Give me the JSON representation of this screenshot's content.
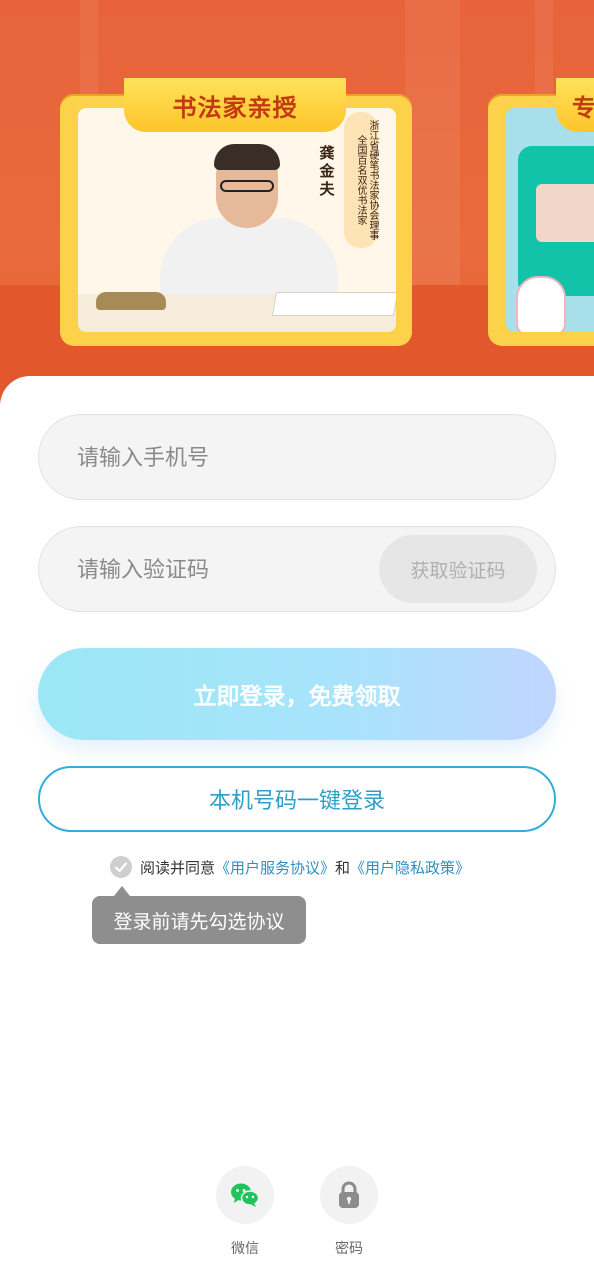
{
  "banner": {
    "card1": {
      "ribbon": "书法家亲授",
      "teacher_name": "龚金夫",
      "teacher_title": "浙江省硬笔书法家协会理事 全国百名双优书法家"
    },
    "card2": {
      "ribbon": "专"
    }
  },
  "form": {
    "phone_placeholder": "请输入手机号",
    "code_placeholder": "请输入验证码",
    "get_code": "获取验证码",
    "login": "立即登录，免费领取",
    "onekey_login": "本机号码一键登录"
  },
  "agreement": {
    "prefix": "阅读并同意",
    "service_link": "《用户服务协议》",
    "and": "和",
    "privacy_link": "《用户隐私政策》",
    "tooltip": "登录前请先勾选协议"
  },
  "alt_login": {
    "wechat_label": "微信",
    "password_label": "密码",
    "wechat_icon": "wechat-icon",
    "password_icon": "lock-icon"
  },
  "colors": {
    "banner": "#e8633a",
    "ribbon": "#fdc52b",
    "accent": "#32aed7"
  }
}
